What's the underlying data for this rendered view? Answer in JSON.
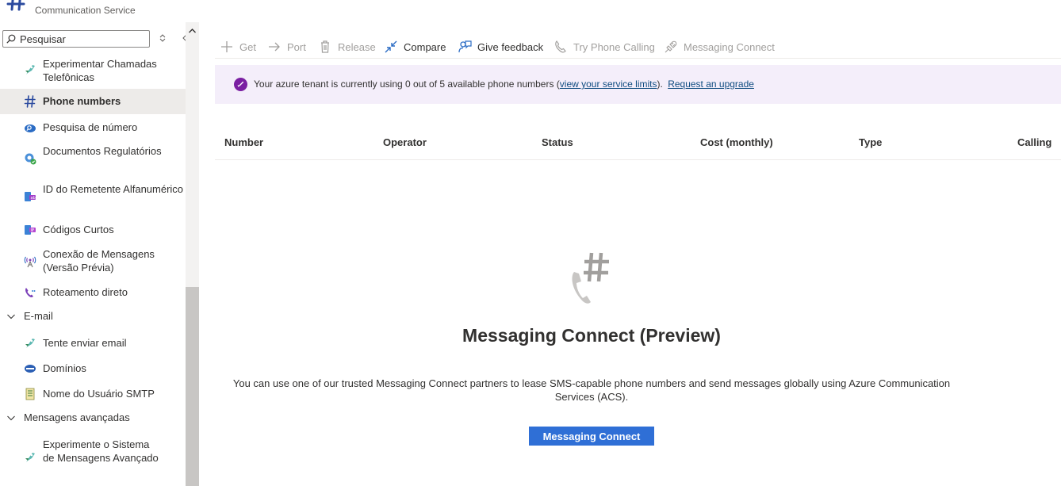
{
  "header": {
    "subtitle": "Communication Service"
  },
  "sidebar": {
    "search_placeholder": "Pesquisar",
    "items": [
      {
        "label": "Experimentar Chamadas Telefônicas",
        "icon": "rocket-icon"
      },
      {
        "label": "Phone numbers",
        "icon": "hash-icon",
        "selected": true
      },
      {
        "label": "Pesquisa de número",
        "icon": "number-search-icon"
      },
      {
        "label": "Documentos Regulatórios",
        "icon": "regulatory-docs-icon"
      },
      {
        "label": "ID do Remetente Alfanumérico",
        "icon": "sender-id-icon"
      },
      {
        "label": "Códigos Curtos",
        "icon": "short-codes-icon"
      },
      {
        "label": "Conexão de Mensagens (Versão Prévia)",
        "icon": "broadcast-icon"
      },
      {
        "label": "Roteamento direto",
        "icon": "phone-routing-icon"
      }
    ],
    "groups": {
      "email": {
        "label": "E-mail",
        "items": [
          {
            "label": "Tente enviar email",
            "icon": "rocket-icon"
          },
          {
            "label": "Domínios",
            "icon": "domains-icon"
          },
          {
            "label": "Nome do Usuário SMTP",
            "icon": "smtp-icon"
          }
        ]
      },
      "advanced": {
        "label": "Mensagens avançadas",
        "items": [
          {
            "label": "Experimente o Sistema de Mensagens Avançado",
            "icon": "rocket-icon"
          }
        ]
      }
    }
  },
  "toolbar": {
    "get": "Get",
    "port": "Port",
    "release": "Release",
    "compare": "Compare",
    "feedback": "Give feedback",
    "try_calling": "Try Phone Calling",
    "messaging_connect": "Messaging Connect"
  },
  "banner": {
    "text_before": "Your azure tenant is currently using 0 out of 5 available phone numbers (",
    "link_limits": "view your service limits",
    "text_after": ").",
    "link_upgrade": "Request an upgrade"
  },
  "table": {
    "columns": [
      "Number",
      "Operator",
      "Status",
      "Cost (monthly)",
      "Type",
      "Calling"
    ]
  },
  "empty_state": {
    "title": "Messaging Connect (Preview)",
    "description": "You can use one of our trusted Messaging Connect partners to lease SMS-capable phone numbers and send messages globally using Azure Communication Services (ACS).",
    "button": "Messaging Connect"
  },
  "colors": {
    "accent": "#2f6fd6",
    "banner_bg": "#f4eefa",
    "banner_icon": "#7a1fa2",
    "selected_bg": "#edebe9"
  }
}
